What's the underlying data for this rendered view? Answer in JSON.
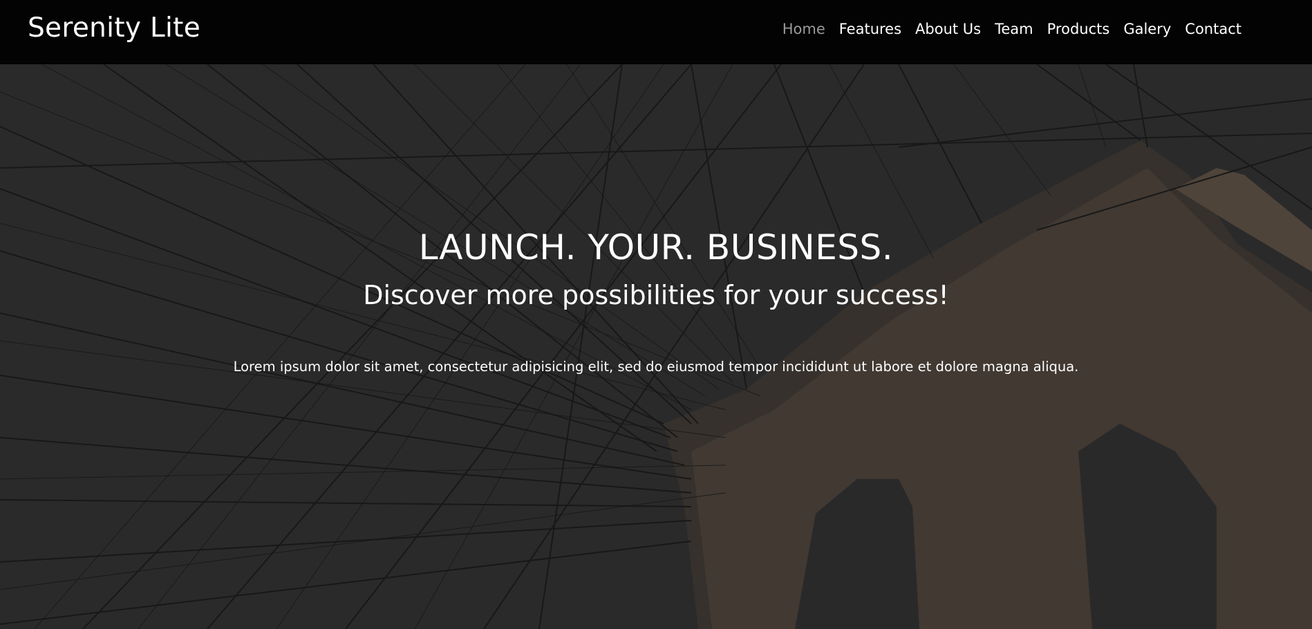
{
  "brand": {
    "name": "Serenity Lite"
  },
  "nav": {
    "items": [
      {
        "label": "Home",
        "active": true
      },
      {
        "label": "Features"
      },
      {
        "label": "About Us"
      },
      {
        "label": "Team"
      },
      {
        "label": "Products"
      },
      {
        "label": "Galery"
      },
      {
        "label": "Contact"
      }
    ]
  },
  "hero": {
    "title": "LAUNCH. YOUR. BUSINESS.",
    "subtitle": "Discover more possibilities for your success!",
    "text": "Lorem ipsum dolor sit amet, consectetur adipisicing elit, sed do eiusmod tempor incididunt ut labore et dolore magna aliqua.",
    "background_image": "bridge-cables-photo",
    "overlay_color": "#2f2f30"
  }
}
